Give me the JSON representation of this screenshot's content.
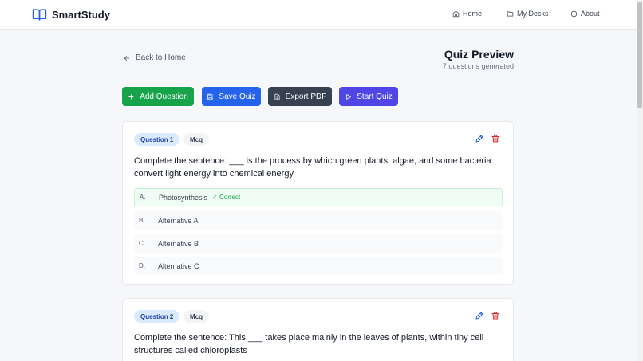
{
  "app": {
    "name": "SmartStudy"
  },
  "nav": {
    "home": "Home",
    "decks": "My Decks",
    "about": "About"
  },
  "page": {
    "back_label": "Back to Home",
    "title": "Quiz Preview",
    "subtitle": "7 questions generated"
  },
  "toolbar": {
    "add": "Add Question",
    "save": "Save Quiz",
    "export": "Export PDF",
    "start": "Start Quiz"
  },
  "questions": [
    {
      "label": "Question 1",
      "type": "Mcq",
      "text": "Complete the sentence: ___ is the process by which green plants, algae, and some bacteria convert light energy into chemical energy",
      "correct_badge": "✓ Correct",
      "options": [
        {
          "letter": "A.",
          "text": "Photosynthesis"
        },
        {
          "letter": "B.",
          "text": "Alternative A"
        },
        {
          "letter": "C.",
          "text": "Alternative B"
        },
        {
          "letter": "D.",
          "text": "Alternative C"
        }
      ]
    },
    {
      "label": "Question 2",
      "type": "Mcq",
      "text": "Complete the sentence: This ___ takes place mainly in the leaves of plants, within tiny cell structures called chloroplasts"
    }
  ],
  "colors": {
    "brand": "#2563eb",
    "add": "#16a34a",
    "save": "#2563eb",
    "export": "#374151",
    "start": "#4f46e5",
    "delete": "#dc2626"
  }
}
